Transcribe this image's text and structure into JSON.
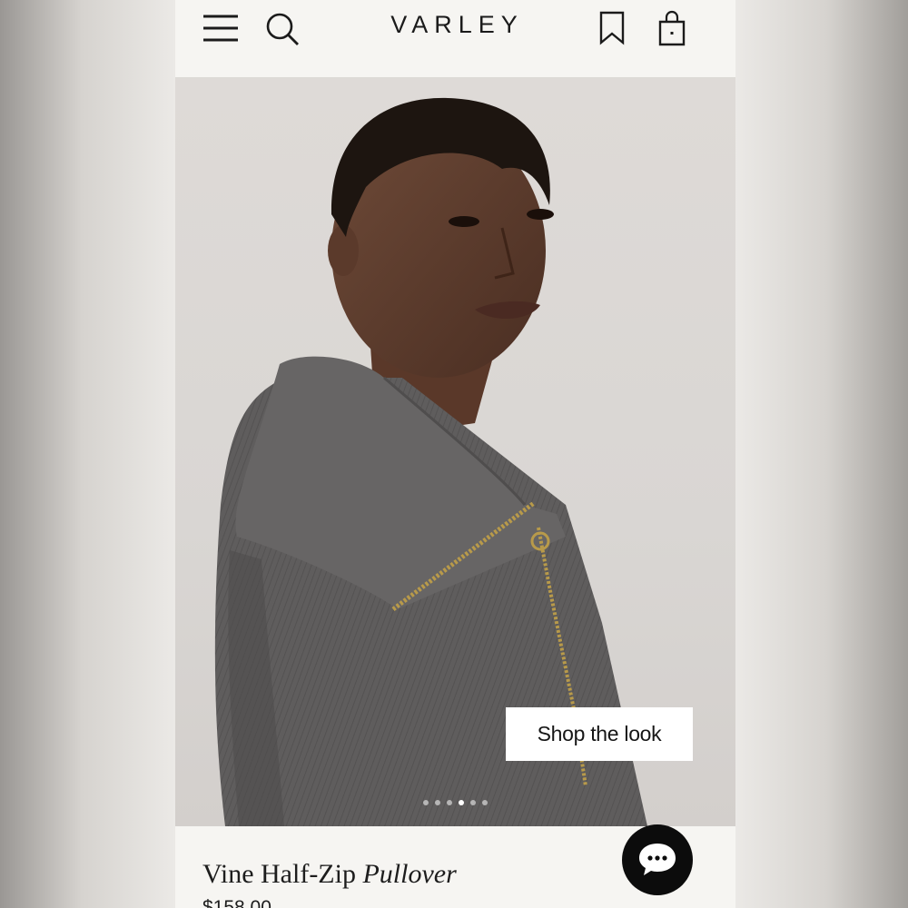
{
  "header": {
    "brand": "VARLEY",
    "icons": [
      "menu-icon",
      "search-icon",
      "bookmark-icon",
      "shopping-bag-icon"
    ]
  },
  "hero": {
    "cta_label": "Shop the look",
    "carousel": {
      "total": 6,
      "active": 4
    }
  },
  "product": {
    "name": "Vine Half-Zip",
    "name_italic": "Pullover",
    "price": "$158.00"
  },
  "chat": {
    "icon": "chat-bubble-icon"
  },
  "colors": {
    "page_bg": "#f6f5f2",
    "text": "#1b1b1b",
    "garment": "#5e5c5c",
    "zipper": "#b89a4a"
  }
}
